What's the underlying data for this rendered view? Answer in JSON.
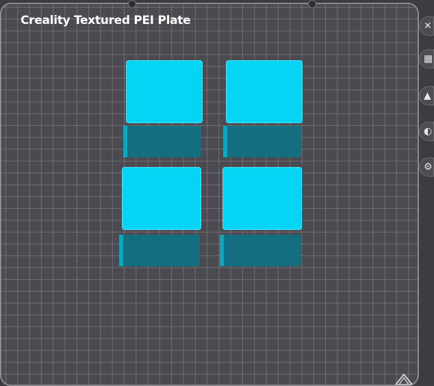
{
  "plate": {
    "title": "Creality Textured PEI Plate"
  },
  "colors": {
    "model_top": "#05d4f5",
    "model_side": "#136f7f",
    "plate_bg": "#4a4a50",
    "grid_line": "#8c8c94"
  },
  "models": [
    {
      "name": "cube-1"
    },
    {
      "name": "cube-2"
    },
    {
      "name": "cube-3"
    },
    {
      "name": "cube-4"
    }
  ],
  "toolbar": {
    "items": [
      {
        "icon": "close-icon",
        "glyph": "✕"
      },
      {
        "icon": "arrange-icon",
        "glyph": "▦"
      },
      {
        "icon": "auto-orient-icon",
        "glyph": "▲"
      },
      {
        "icon": "lay-on-face-icon",
        "glyph": "◐"
      },
      {
        "icon": "settings-icon",
        "glyph": "⚙"
      }
    ]
  }
}
